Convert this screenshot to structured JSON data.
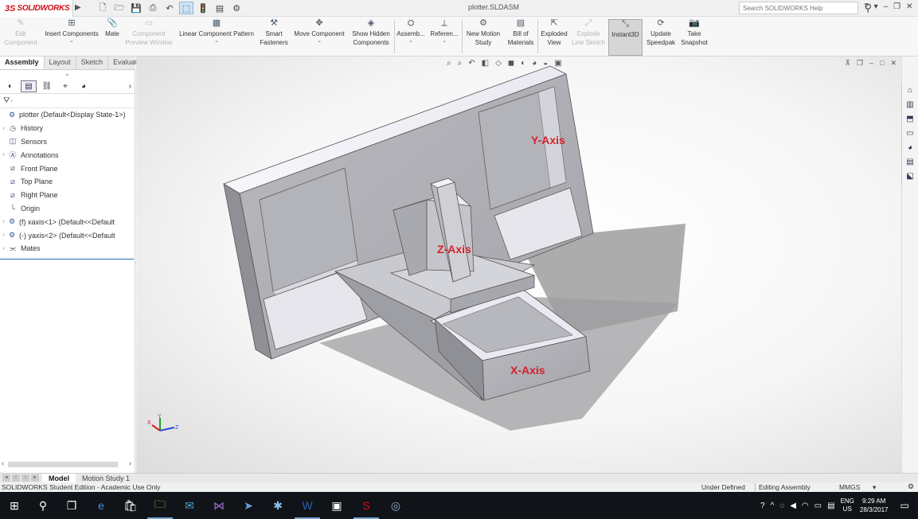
{
  "app": {
    "logo_prefix": "3S",
    "logo_text": "SOLIDWORKS",
    "document_title": "plotter.SLDASM",
    "search_placeholder": "Search SOLIDWORKS Help"
  },
  "quick_access": [
    "new-icon",
    "open-icon",
    "save-icon",
    "print-icon",
    "undo-icon",
    "select-icon",
    "rebuild-icon",
    "file-properties-icon",
    "options-icon"
  ],
  "command_manager": [
    {
      "label": "Edit Component",
      "icon": "edit-component-icon",
      "enabled": false
    },
    {
      "label": "Insert Components",
      "icon": "insert-components-icon",
      "enabled": true
    },
    {
      "label": "Mate",
      "icon": "mate-icon",
      "enabled": true
    },
    {
      "label": "Component Preview Window",
      "icon": "preview-window-icon",
      "enabled": false
    },
    {
      "label": "Linear Component Pattern",
      "icon": "linear-pattern-icon",
      "enabled": true
    },
    {
      "label": "Smart Fasteners",
      "icon": "smart-fasteners-icon",
      "enabled": true
    },
    {
      "label": "Move Component",
      "icon": "move-component-icon",
      "enabled": true
    },
    {
      "label": "Show Hidden Components",
      "icon": "show-hidden-icon",
      "enabled": true
    },
    {
      "label": "Assemb...",
      "icon": "assembly-features-icon",
      "enabled": true
    },
    {
      "label": "Referen...",
      "icon": "reference-geometry-icon",
      "enabled": true
    },
    {
      "label": "New Motion Study",
      "icon": "motion-study-icon",
      "enabled": true
    },
    {
      "label": "Bill of Materials",
      "icon": "bom-icon",
      "enabled": true
    },
    {
      "label": "Exploded View",
      "icon": "exploded-view-icon",
      "enabled": true
    },
    {
      "label": "Explode Line Sketch",
      "icon": "explode-line-icon",
      "enabled": false
    },
    {
      "label": "Instant3D",
      "icon": "instant3d-icon",
      "enabled": true,
      "active": true
    },
    {
      "label": "Update Speedpak",
      "icon": "speedpak-icon",
      "enabled": true
    },
    {
      "label": "Take Snapshot",
      "icon": "snapshot-icon",
      "enabled": true
    }
  ],
  "tabs": [
    "Assembly",
    "Layout",
    "Sketch",
    "Evaluate"
  ],
  "feature_tree": {
    "filter_icon": "filter-icon",
    "nodes": [
      {
        "label": "plotter  (Default<Display State-1>)",
        "expand": ""
      },
      {
        "label": "History",
        "expand": "›"
      },
      {
        "label": "Sensors",
        "expand": ""
      },
      {
        "label": "Annotations",
        "expand": "›"
      },
      {
        "label": "Front Plane",
        "expand": ""
      },
      {
        "label": "Top Plane",
        "expand": ""
      },
      {
        "label": "Right Plane",
        "expand": ""
      },
      {
        "label": "Origin",
        "expand": ""
      },
      {
        "label": "(f) xaxis<1> (Default<<Default",
        "expand": "›"
      },
      {
        "label": "(-) yaxis<2> (Default<<Default",
        "expand": "›"
      },
      {
        "label": "Mates",
        "expand": "›"
      }
    ]
  },
  "viewport": {
    "labels": {
      "y_axis": "Y-Axis",
      "z_axis": "Z-Axis",
      "x_axis": "X-Axis"
    },
    "triad": {
      "x": "X",
      "y": "Y",
      "z": "Z"
    }
  },
  "bottom_tabs": [
    "Model",
    "Motion Study 1"
  ],
  "status": {
    "left": "SOLIDWORKS Student Edition - Academic Use Only",
    "definition": "Under Defined",
    "mode": "Editing Assembly",
    "units": "MMGS",
    "arrow": "▾"
  },
  "taskbar": {
    "language": "ENG",
    "region": "US",
    "time": "9:29 AM",
    "date": "28/3/2017"
  },
  "colors": {
    "accent": "#d0101a",
    "axis_label": "#d8202a",
    "taskbar_bg": "#101418"
  }
}
